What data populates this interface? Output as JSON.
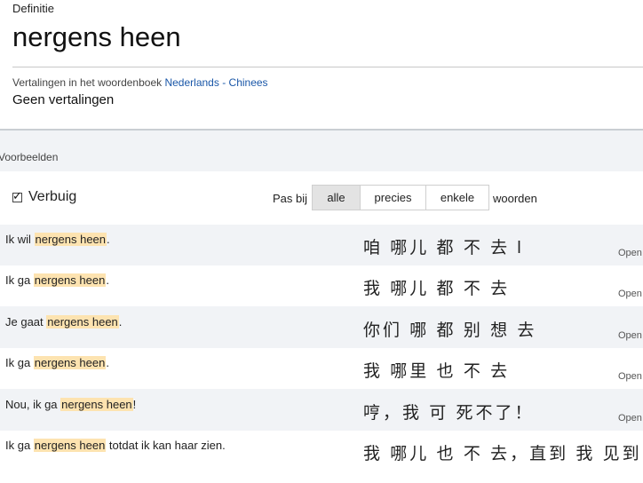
{
  "definition": {
    "label": "Definitie",
    "word": "nergens heen",
    "dict_prefix": "Vertalingen in het woordenboek",
    "lang_from": "Nederlands",
    "dash": "-",
    "lang_to": "Chinees",
    "no_translations": "Geen vertalingen"
  },
  "examples": {
    "heading": "Voorbeelden",
    "inflect_label": "Verbuig",
    "inflect_checked": true,
    "match_label": "Pas bij",
    "match_options": [
      "alle",
      "precies",
      "enkele"
    ],
    "match_selected": "alle",
    "words_label": "woorden",
    "open_label": "Open",
    "highlight_color": "#fde3b0",
    "rows": [
      {
        "pre": "Ik wil ",
        "hl": "nergens heen",
        "post": ".",
        "zh": "咱 哪儿 都 不 去 l",
        "open": "Open"
      },
      {
        "pre": "Ik ga ",
        "hl": "nergens heen",
        "post": ".",
        "zh": "我 哪儿 都 不 去",
        "open": "Open"
      },
      {
        "pre": "Je gaat ",
        "hl": "nergens heen",
        "post": ".",
        "zh": "你们 哪 都 别 想 去",
        "open": "Open"
      },
      {
        "pre": "Ik ga ",
        "hl": "nergens heen",
        "post": ".",
        "zh": "我 哪里 也 不 去",
        "open": "Open"
      },
      {
        "pre": "Nou, ik ga ",
        "hl": "nergens heen",
        "post": "!",
        "zh": "哼，我 可 死不了！",
        "open": "Open"
      },
      {
        "pre": "Ik ga ",
        "hl": "nergens heen",
        "post": " totdat ik kan haar zien.",
        "zh": "我 哪儿 也 不 去，直到 我 见到 她",
        "open": ""
      }
    ]
  }
}
